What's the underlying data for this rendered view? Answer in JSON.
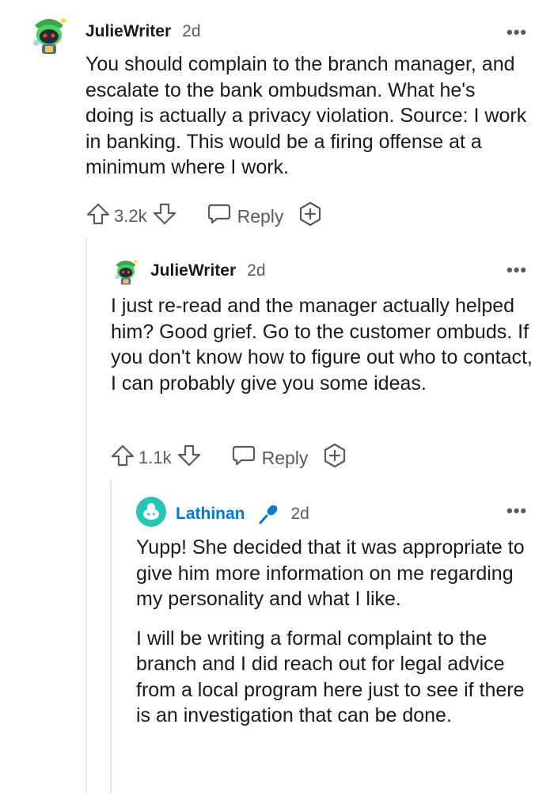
{
  "comments": [
    {
      "username": "JulieWriter",
      "time": "2d",
      "more": "•••",
      "body": [
        "You should complain to the branch manager, and escalate to the bank ombudsman. What he's doing is actually a privacy violation. Source: I work in banking. This would be a firing offense at a minimum where I work."
      ],
      "votes": "3.2k",
      "reply_label": "Reply"
    },
    {
      "username": "JulieWriter",
      "time": "2d",
      "more": "•••",
      "body": [
        "I just re-read and the manager actually helped him? Good grief. Go to the customer ombuds. If you don't know how to figure out who to contact, I can probably give you some ideas."
      ],
      "votes": "1.1k",
      "reply_label": "Reply"
    },
    {
      "username": "Lathinan",
      "time": "2d",
      "more": "•••",
      "body": [
        "Yupp! She decided that it was appropriate to give him more information on me regarding my personality and what I like.",
        "I will be writing a formal complaint to the branch and I did reach out for legal advice from a local program here just to see if there is an investigation that can be done."
      ]
    }
  ],
  "icons": {
    "upvote": "arrow-up-icon",
    "downvote": "arrow-down-icon",
    "reply": "speech-bubble-icon",
    "award": "add-award-icon",
    "flair": "microphone-icon"
  },
  "colors": {
    "op_name": "#1a1a1b",
    "lathinan_name": "#0079d3",
    "meta": "#555c63",
    "avatar_green": "#46d160",
    "avatar_teal": "#25c7b3"
  }
}
